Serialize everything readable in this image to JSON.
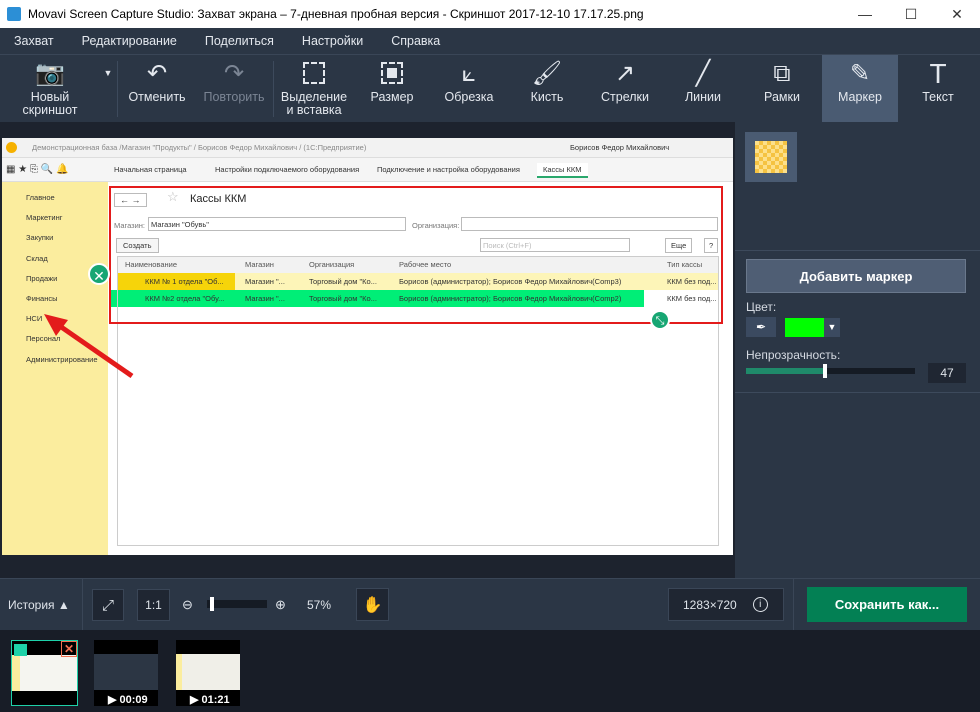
{
  "window": {
    "title": "Movavi Screen Capture Studio: Захват экрана – 7-дневная пробная версия - Скриншот 2017-12-10 17.17.25.png",
    "minimize": "—",
    "maximize": "☐",
    "close": "✕"
  },
  "menu": [
    "Захват",
    "Редактирование",
    "Поделиться",
    "Настройки",
    "Справка"
  ],
  "toolbar": {
    "new_screenshot": "Новый скриншот",
    "undo": "Отменить",
    "redo": "Повторить",
    "select_paste": "Выделение и вставка",
    "resize": "Размер",
    "crop": "Обрезка",
    "brush": "Кисть",
    "arrows": "Стрелки",
    "lines": "Линии",
    "frames": "Рамки",
    "marker": "Маркер",
    "text": "Текст"
  },
  "screenshot": {
    "title_bar": "Демонстрационная база /Магазин \"Продукты\" / Борисов Федор Михайлович / (1С:Предприятие)",
    "user": "Борисов Федор Михайлович",
    "tabs": [
      "Начальная страница",
      "Настройки подключаемого оборудования",
      "Подключение и настройка оборудования",
      "Кассы ККМ"
    ],
    "sidebar": [
      "Главное",
      "Маркетинг",
      "Закупки",
      "Склад",
      "Продажи",
      "Финансы",
      "НСИ",
      "Персонал",
      "Администрирование"
    ],
    "form_title": "Кассы ККМ",
    "shop_label": "Магазин:",
    "shop_value": "Магазин \"Обувь\"",
    "org_label": "Организация:",
    "create": "Создать",
    "search_placeholder": "Поиск (Ctrl+F)",
    "more": "Еще",
    "help": "?",
    "columns": [
      "Наименование",
      "Магазин",
      "Организация",
      "Рабочее место",
      "Тип кассы"
    ],
    "rows": [
      [
        "ККМ № 1 отдела \"Об...",
        "Магазин \"...",
        "Торговый дом \"Ко...",
        "Борисов (администратор); Борисов Федор Михайлович(Comp3)",
        "ККМ без под..."
      ],
      [
        "ККМ №2 отдела \"Обу...",
        "Магазин \"...",
        "Торговый дом \"Ко...",
        "Борисов (администратор); Борисов Федор Михайлович(Comp2)",
        "ККМ без под..."
      ]
    ]
  },
  "right_panel": {
    "add_marker": "Добавить маркер",
    "color_label": "Цвет:",
    "color": "#00ff00",
    "opacity_label": "Непрозрачность:",
    "opacity": 47
  },
  "bottom": {
    "history": "История ▲",
    "one_to_one": "1:1",
    "zoom": "57%",
    "zoom_fraction": 0.05,
    "size": "1283×720",
    "save": "Сохранить как..."
  },
  "thumbnails": [
    {
      "duration": ""
    },
    {
      "duration": "00:09"
    },
    {
      "duration": "01:21"
    }
  ]
}
